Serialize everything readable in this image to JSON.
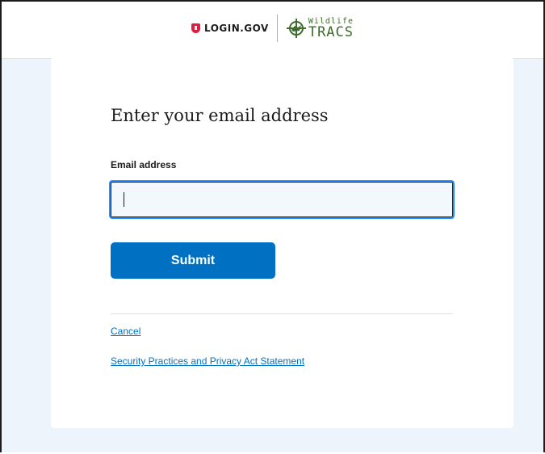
{
  "header": {
    "logo_text": "LOGIN.GOV",
    "partner_top": "Wildlife",
    "partner_bottom": "TRACS"
  },
  "form": {
    "title": "Enter your email address",
    "email_label": "Email address",
    "email_value": "",
    "submit_label": "Submit"
  },
  "links": {
    "cancel": "Cancel",
    "privacy": "Security Practices and Privacy Act Statement"
  },
  "colors": {
    "accent": "#0071c2",
    "brand_red": "#e21c3d",
    "background": "#eef4fb",
    "partner_green": "#3f6b2c"
  }
}
